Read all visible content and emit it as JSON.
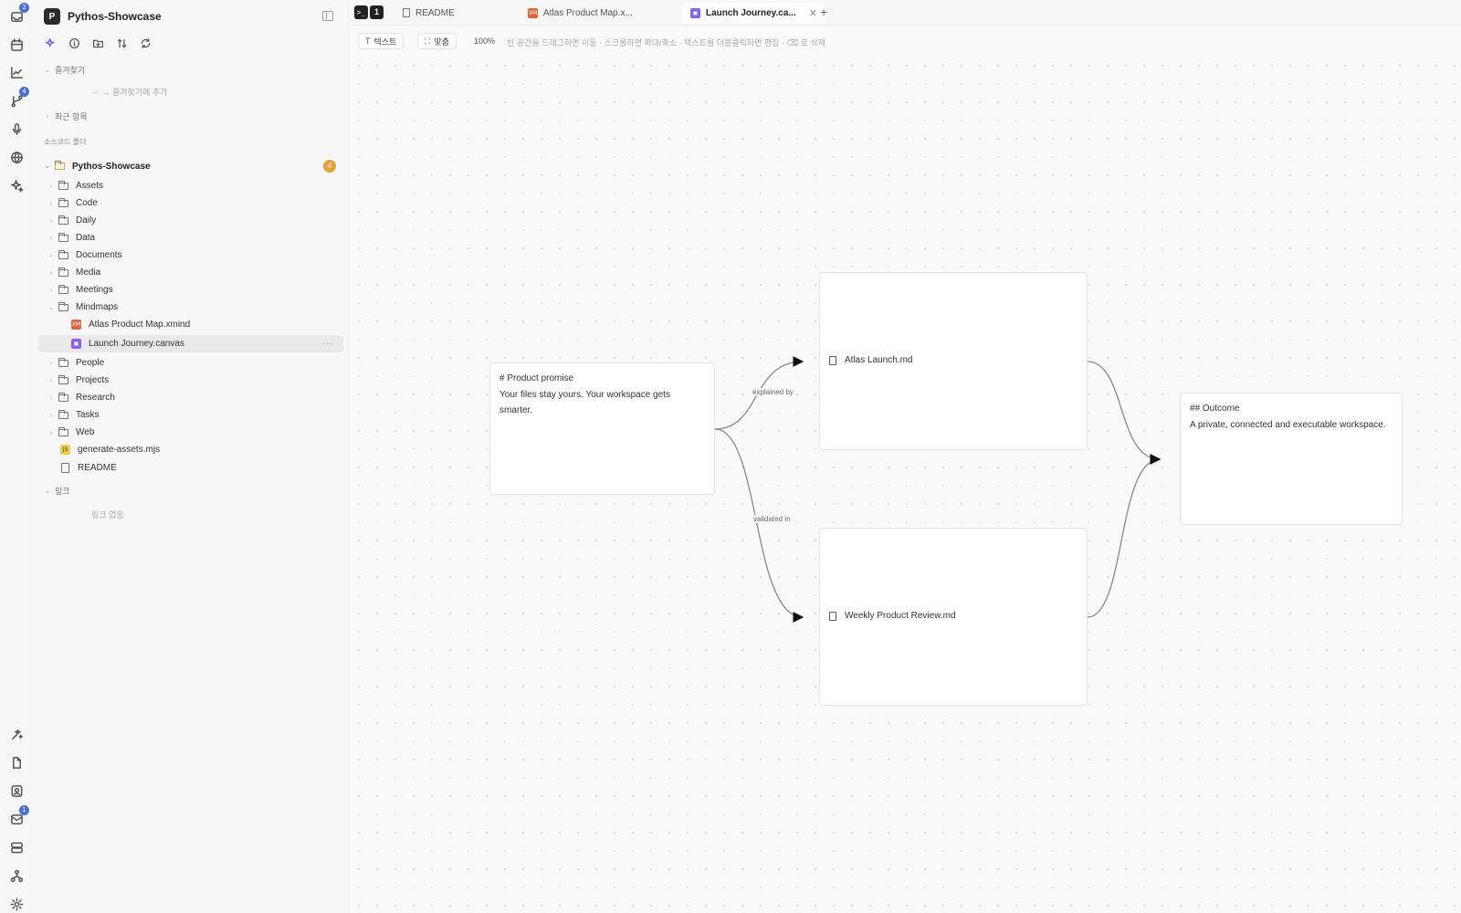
{
  "activity_bar": {
    "inbox_badge": "2",
    "git_badge": "4",
    "mail_badge": "1"
  },
  "sidebar": {
    "workspace_initial": "P",
    "workspace_name": "Pythos-Showcase",
    "favorites_label": "즐겨찾기",
    "favorites_empty": "··· → 즐겨찾기에 추가",
    "recent_label": "최근 항목",
    "source_folder_label": "소스코드 폴더",
    "root_name": "Pythos-Showcase",
    "root_badge": "4",
    "folders": [
      "Assets",
      "Code",
      "Daily",
      "Data",
      "Documents",
      "Media",
      "Meetings",
      "Mindmaps"
    ],
    "mindmap_files": [
      "Atlas Product Map.xmind",
      "Launch Journey.canvas"
    ],
    "folders_after": [
      "People",
      "Projects",
      "Research",
      "Tasks",
      "Web"
    ],
    "root_files": [
      "generate-assets.mjs",
      "README"
    ],
    "links_label": "링크",
    "links_empty": "링크 없음"
  },
  "tabs": {
    "terminal_count": "1",
    "items": [
      {
        "label": "README"
      },
      {
        "label": "Atlas Product Map.x..."
      },
      {
        "label": "Launch Journey.ca..."
      }
    ]
  },
  "canvas_toolbar": {
    "text_button": "텍스트",
    "fit_button": "맞춤",
    "zoom": "100%",
    "hint": "빈 공간을 드래그하면 이동 · 스크롤하면 확대/축소 · 텍스트를 더블클릭하면 편집 · ⌫ 로 삭제"
  },
  "canvas": {
    "nodes": {
      "promise": {
        "title": "# Product promise",
        "body": "Your files stay yours. Your workspace gets smarter."
      },
      "atlas": {
        "file": "Atlas Launch.md"
      },
      "weekly": {
        "file": "Weekly Product Review.md"
      },
      "outcome": {
        "title": "## Outcome",
        "body": "A private, connected and executable workspace."
      }
    },
    "edges": {
      "explained_by": "explained by",
      "validated_in": "validated in"
    }
  },
  "colors": {
    "xmind_orange": "#e2643b",
    "canvas_purple": "#8a63e8",
    "js_yellow": "#f0d04a",
    "badge_blue": "#4a6fd6",
    "badge_orange": "#e6a23c"
  }
}
